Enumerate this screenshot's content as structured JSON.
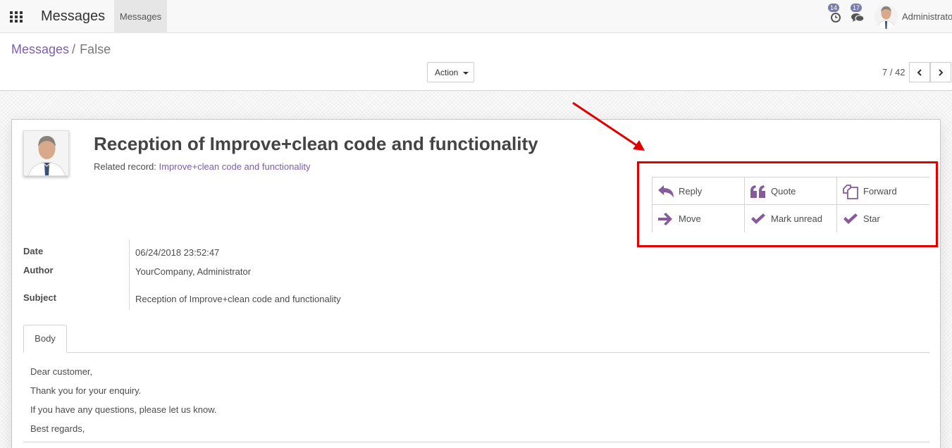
{
  "navbar": {
    "app_title": "Messages",
    "menu_item": "Messages",
    "activity_count": "14",
    "messages_count": "17",
    "user_name": "Administrator"
  },
  "breadcrumb": {
    "parent": "Messages",
    "separator": "/",
    "current": "False"
  },
  "control_panel": {
    "action_label": "Action",
    "pager": "7 / 42"
  },
  "record": {
    "title": "Reception of Improve+clean code and functionality",
    "related_label": "Related record:",
    "related_value": "Improve+clean code and functionality"
  },
  "actions": [
    {
      "label": "Reply",
      "icon": "reply-icon"
    },
    {
      "label": "Quote",
      "icon": "quote-icon"
    },
    {
      "label": "Forward",
      "icon": "forward-icon"
    },
    {
      "label": "Move",
      "icon": "arrow-right-icon"
    },
    {
      "label": "Mark unread",
      "icon": "check-icon"
    },
    {
      "label": "Star",
      "icon": "check-icon"
    }
  ],
  "fields": {
    "date_label": "Date",
    "date_value": "06/24/2018 23:52:47",
    "author_label": "Author",
    "author_value": "YourCompany, Administrator",
    "subject_label": "Subject",
    "subject_value": "Reception of Improve+clean code and functionality"
  },
  "tabs": {
    "body": "Body"
  },
  "body": {
    "lines": [
      "Dear customer,",
      "Thank you for your enquiry.",
      "If you have any questions, please let us know.",
      "Best regards,"
    ]
  },
  "colors": {
    "accent": "#7c5fa8",
    "icon": "#875a9b",
    "annotation": "#e00000"
  }
}
